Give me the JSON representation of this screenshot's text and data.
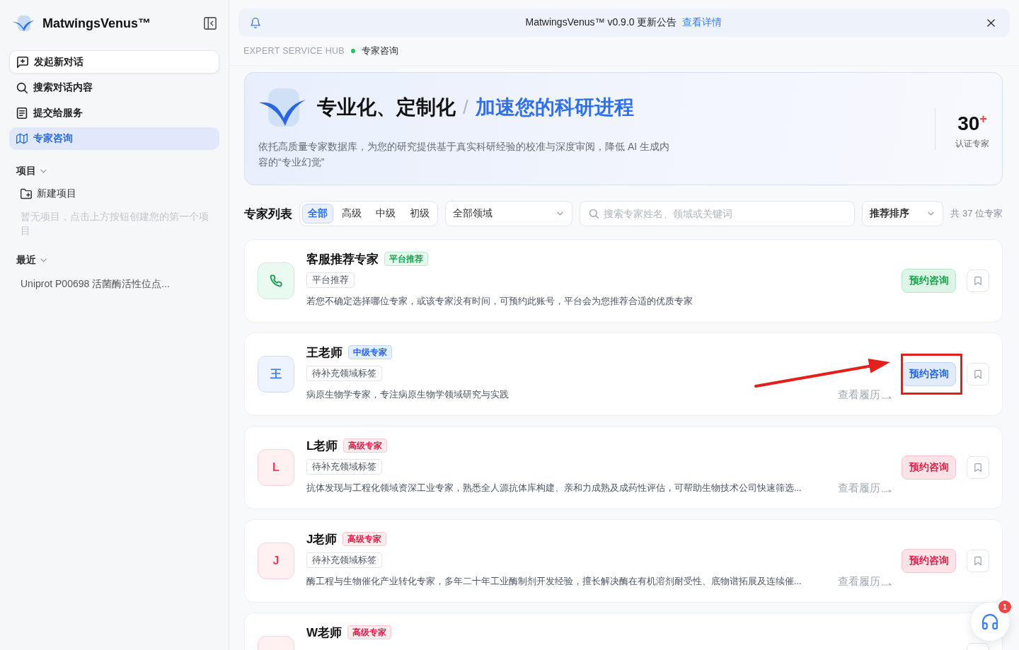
{
  "sidebar": {
    "app_name": "MatwingsVenus™",
    "new_chat_button": "发起新对话",
    "nav": [
      {
        "label": "搜索对话内容",
        "selected": false
      },
      {
        "label": "提交给服务",
        "selected": false
      },
      {
        "label": "专家咨询",
        "selected": true
      }
    ],
    "projects": {
      "title": "项目",
      "expanded": true,
      "new_project": "新建项目",
      "empty_hint": "暂无项目，点击上方按钮创建您的第一个项目"
    },
    "recent": {
      "title": "最近",
      "expanded": true,
      "items": [
        {
          "label": "Uniprot P00698 活菌酶活性位点...",
          "selected": false
        }
      ]
    }
  },
  "announcement": {
    "text": "MatwingsVenus™ v0.9.0 更新公告",
    "link": "查看详情"
  },
  "breadcrumb": {
    "section": "EXPERT SERVICE HUB",
    "page": "专家咨询"
  },
  "hero": {
    "title": "专业化、定制化",
    "separator": "/",
    "highlight": "加速您的科研进程",
    "description": "依托高质量专家数据库，为您的研究提供基于真实科研经验的校准与深度审阅，降低 AI 生成内容的“专业幻觉”",
    "stat_value": "30$^{+}$",
    "stat_label": "认证专家"
  },
  "filters": {
    "title": "专家列表",
    "tiers": [
      {
        "label": "全部",
        "selected": true
      },
      {
        "label": "高级",
        "selected": false
      },
      {
        "label": "中级",
        "selected": false
      },
      {
        "label": "初级",
        "selected": false
      }
    ],
    "field_select": "全部领域",
    "search": {
      "placeholder": "搜索专家姓名、领域或关键词"
    },
    "sort_select": "推荐排序",
    "count": "共 37 位专家"
  },
  "experts": [
    {
      "kind": "platform",
      "name": "客服推荐专家",
      "badge": "平台推荐",
      "tag": "平台推荐",
      "description": "若您不确定选择哪位专家，或该专家没有时间，可预约此账号，平台会为您推荐合适的优质专家",
      "button": "预约咨询",
      "bookmarked": false,
      "highlighted": false
    },
    {
      "kind": "intermediate",
      "avatar": "王",
      "name": "王老师",
      "badge": "中级专家",
      "tag": "待补充领域标签",
      "description": "病原生物学专家，专注病原生物学领域研究与实践",
      "profile_link": "查看履历",
      "button": "预约咨询",
      "bookmarked": false,
      "highlighted": true
    },
    {
      "kind": "senior",
      "avatar": "L",
      "name": "L老师",
      "badge": "高级专家",
      "tag": "待补充领域标签",
      "description": "抗体发现与工程化领域资深工业专家，熟悉全人源抗体库构建、亲和力成熟及成药性评估，可帮助生物技术公司快速筛选...",
      "profile_link": "查看履历",
      "button": "预约咨询",
      "bookmarked": false,
      "highlighted": false
    },
    {
      "kind": "senior",
      "avatar": "J",
      "name": "J老师",
      "badge": "高级专家",
      "tag": "待补充领域标签",
      "description": "酶工程与生物催化产业转化专家，多年二十年工业酶制剂开发经验，擅长解决酶在有机溶剂耐受性、底物谱拓展及连续催...",
      "profile_link": "查看履历",
      "button": "预约咨询",
      "bookmarked": false,
      "highlighted": false
    },
    {
      "kind": "senior",
      "name": "W老师",
      "badge": "高级专家",
      "highlighted": false
    }
  ],
  "support": {
    "badge": "1"
  }
}
